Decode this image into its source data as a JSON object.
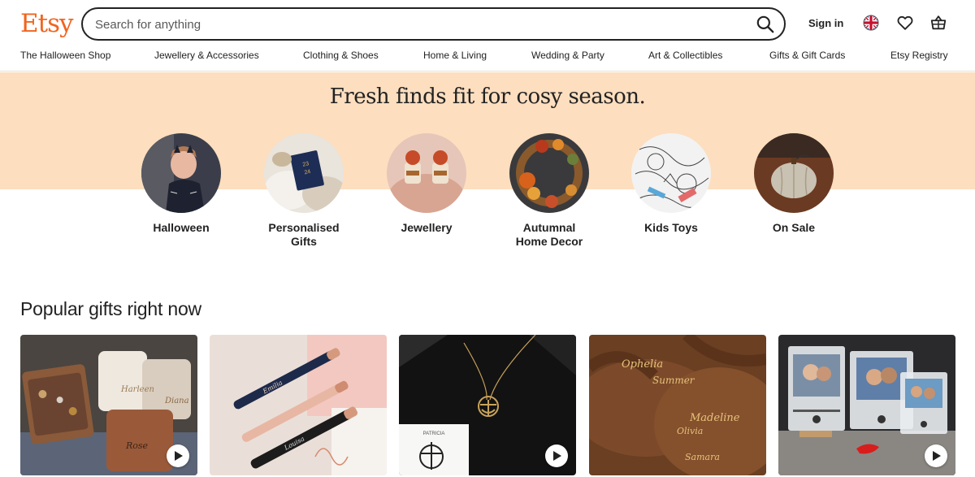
{
  "header": {
    "logo": "Etsy",
    "search_placeholder": "Search for anything",
    "signin_label": "Sign in"
  },
  "nav": {
    "items": [
      "The Halloween Shop",
      "Jewellery & Accessories",
      "Clothing & Shoes",
      "Home & Living",
      "Wedding & Party",
      "Art & Collectibles",
      "Gifts & Gift Cards",
      "Etsy Registry"
    ]
  },
  "hero": {
    "title": "Fresh finds fit for cosy season.",
    "categories": [
      {
        "label": "Halloween"
      },
      {
        "label": "Personalised\nGifts"
      },
      {
        "label": "Jewellery"
      },
      {
        "label": "Autumnal\nHome Decor"
      },
      {
        "label": "Kids Toys"
      },
      {
        "label": "On Sale"
      }
    ]
  },
  "popular": {
    "title": "Popular gifts right now",
    "card_texts": {
      "card1_names": [
        "Harleen",
        "Diana",
        "Rose"
      ],
      "card2_names": [
        "Emilia",
        "Louisa"
      ],
      "card3_name": "PATRICIA",
      "card4_names": [
        "Ophelia",
        "Summer",
        "Madeline",
        "Olivia",
        "Samara"
      ]
    }
  },
  "colors": {
    "brand": "#F1641E",
    "hero_band": "#FDDEBF"
  },
  "icons": [
    "search-icon",
    "uk-flag-icon",
    "heart-icon",
    "basket-icon",
    "play-icon"
  ]
}
